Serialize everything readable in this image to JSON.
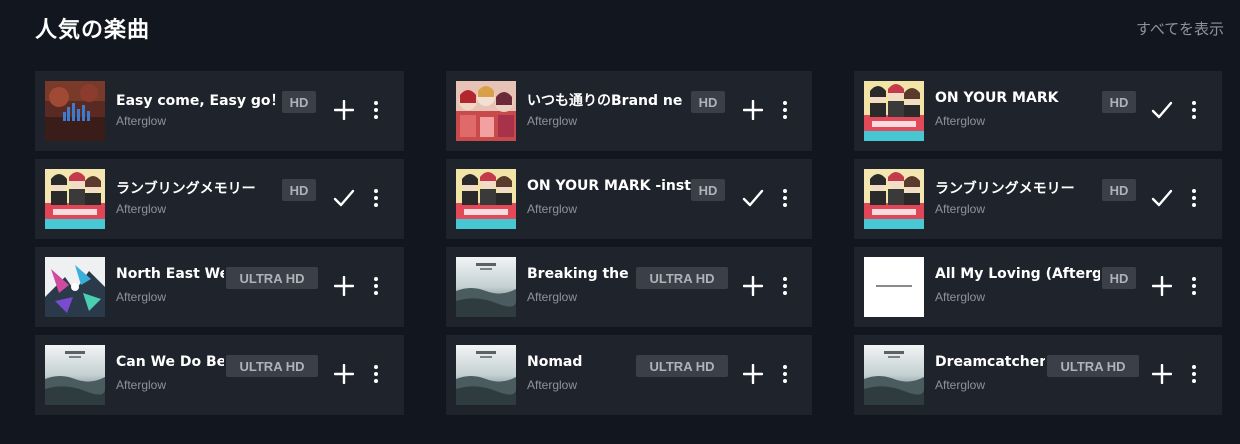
{
  "section": {
    "title": "人気の楽曲",
    "see_all": "すべてを表示"
  },
  "tracks": [
    {
      "title": "Easy come, Easy go！",
      "artist": "Afterglow",
      "quality": "HD",
      "added": false,
      "art": "easy-come-art"
    },
    {
      "title": "いつも通りのBrand ne",
      "artist": "Afterglow",
      "quality": "HD",
      "added": false,
      "art": "itsumo-doori-art"
    },
    {
      "title": "ON YOUR MARK",
      "artist": "Afterglow",
      "quality": "HD",
      "added": true,
      "art": "on-your-mark-art"
    },
    {
      "title": "ランブリングメモリー",
      "artist": "Afterglow",
      "quality": "HD",
      "added": true,
      "art": "rambling-memory-art"
    },
    {
      "title": "ON YOUR MARK -instr",
      "artist": "Afterglow",
      "quality": "HD",
      "added": true,
      "art": "on-your-mark-art"
    },
    {
      "title": "ランブリングメモリー",
      "artist": "Afterglow",
      "quality": "HD",
      "added": true,
      "art": "rambling-memory-art"
    },
    {
      "title": "North East We",
      "artist": "Afterglow",
      "quality": "ULTRA HD",
      "added": false,
      "art": "north-east-art"
    },
    {
      "title": "Breaking the S",
      "artist": "Afterglow",
      "quality": "ULTRA HD",
      "added": false,
      "art": "afterglow-album-art"
    },
    {
      "title": "All My Loving (Aftergl",
      "artist": "Afterglow",
      "quality": "HD",
      "added": false,
      "art": "all-my-loving-art"
    },
    {
      "title": "Can We Do Bet",
      "artist": "Afterglow",
      "quality": "ULTRA HD",
      "added": false,
      "art": "afterglow-album-art"
    },
    {
      "title": "Nomad",
      "artist": "Afterglow",
      "quality": "ULTRA HD",
      "added": false,
      "art": "afterglow-album-art"
    },
    {
      "title": "Dreamcatcher",
      "artist": "Afterglow",
      "quality": "ULTRA HD",
      "added": false,
      "art": "afterglow-album-art"
    }
  ],
  "icons": {
    "add": "plus-icon",
    "added": "check-icon",
    "more": "more-vertical-icon"
  },
  "colors": {
    "background": "#12161f",
    "card": "#1f232c",
    "badge_bg": "#3a3f48",
    "badge_text": "#aeb3ba",
    "secondary_text": "#8d939c"
  }
}
